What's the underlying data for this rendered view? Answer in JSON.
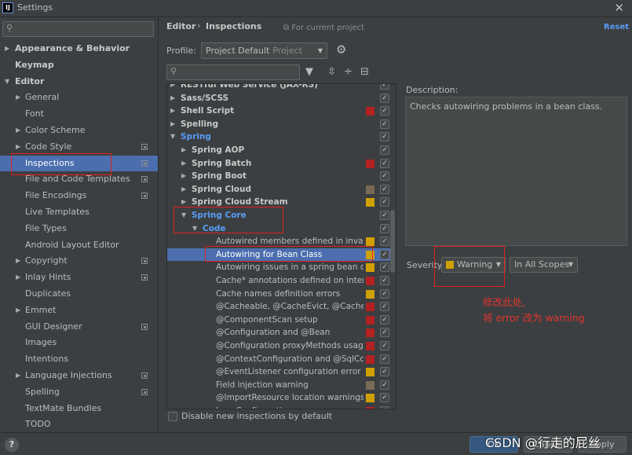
{
  "window": {
    "title": "Settings",
    "app_icon": "IJ"
  },
  "left": {
    "search_placeholder": "",
    "items": [
      {
        "label": "Appearance & Behavior",
        "level": 0,
        "arrow": "right",
        "bold": true
      },
      {
        "label": "Keymap",
        "level": 0,
        "arrow": "",
        "bold": true
      },
      {
        "label": "Editor",
        "level": 0,
        "arrow": "down",
        "bold": true
      },
      {
        "label": "General",
        "level": 1,
        "arrow": "right"
      },
      {
        "label": "Font",
        "level": 1,
        "arrow": ""
      },
      {
        "label": "Color Scheme",
        "level": 1,
        "arrow": "right"
      },
      {
        "label": "Code Style",
        "level": 1,
        "arrow": "right",
        "copy": true
      },
      {
        "label": "Inspections",
        "level": 1,
        "arrow": "",
        "copy": true,
        "selected": true
      },
      {
        "label": "File and Code Templates",
        "level": 1,
        "arrow": "",
        "copy": true
      },
      {
        "label": "File Encodings",
        "level": 1,
        "arrow": "",
        "copy": true
      },
      {
        "label": "Live Templates",
        "level": 1,
        "arrow": ""
      },
      {
        "label": "File Types",
        "level": 1,
        "arrow": ""
      },
      {
        "label": "Android Layout Editor",
        "level": 1,
        "arrow": ""
      },
      {
        "label": "Copyright",
        "level": 1,
        "arrow": "right",
        "copy": true
      },
      {
        "label": "Inlay Hints",
        "level": 1,
        "arrow": "right",
        "copy": true
      },
      {
        "label": "Duplicates",
        "level": 1,
        "arrow": ""
      },
      {
        "label": "Emmet",
        "level": 1,
        "arrow": "right"
      },
      {
        "label": "GUI Designer",
        "level": 1,
        "arrow": "",
        "copy": true
      },
      {
        "label": "Images",
        "level": 1,
        "arrow": ""
      },
      {
        "label": "Intentions",
        "level": 1,
        "arrow": ""
      },
      {
        "label": "Language Injections",
        "level": 1,
        "arrow": "right",
        "copy": true
      },
      {
        "label": "Spelling",
        "level": 1,
        "arrow": "",
        "copy": true
      },
      {
        "label": "TextMate Bundles",
        "level": 1,
        "arrow": ""
      },
      {
        "label": "TODO",
        "level": 1,
        "arrow": ""
      }
    ]
  },
  "header": {
    "crumb_1": "Editor",
    "crumb_sep": "›",
    "crumb_2": "Inspections",
    "project_note": "For current project",
    "reset": "Reset"
  },
  "profile": {
    "label": "Profile:",
    "value": "Project Default",
    "scope": "Project"
  },
  "inspections": {
    "rows": [
      {
        "label": "RESTful Web Service (JAX-RS)",
        "level": 0,
        "arrow": "right",
        "style": "bold",
        "sev": "",
        "checked": true
      },
      {
        "label": "Sass/SCSS",
        "level": 0,
        "arrow": "right",
        "style": "bold",
        "sev": "",
        "checked": true
      },
      {
        "label": "Shell Script",
        "level": 0,
        "arrow": "right",
        "style": "bold",
        "sev": "#b32121",
        "checked": true
      },
      {
        "label": "Spelling",
        "level": 0,
        "arrow": "right",
        "style": "bold",
        "sev": "",
        "checked": true
      },
      {
        "label": "Spring",
        "level": 0,
        "arrow": "down",
        "style": "blue",
        "sev": "",
        "checked": true
      },
      {
        "label": "Spring AOP",
        "level": 1,
        "arrow": "right",
        "style": "bold",
        "sev": "",
        "checked": true
      },
      {
        "label": "Spring Batch",
        "level": 1,
        "arrow": "right",
        "style": "bold",
        "sev": "#b32121",
        "checked": true
      },
      {
        "label": "Spring Boot",
        "level": 1,
        "arrow": "right",
        "style": "bold",
        "sev": "",
        "checked": true
      },
      {
        "label": "Spring Cloud",
        "level": 1,
        "arrow": "right",
        "style": "bold",
        "sev": "#7a6a55",
        "checked": true
      },
      {
        "label": "Spring Cloud Stream",
        "level": 1,
        "arrow": "right",
        "style": "bold",
        "sev": "#d0a000",
        "checked": true
      },
      {
        "label": "Spring Core",
        "level": 1,
        "arrow": "down",
        "style": "blue",
        "sev": "",
        "checked": true
      },
      {
        "label": "Code",
        "level": 2,
        "arrow": "down",
        "style": "blue",
        "sev": "",
        "checked": true
      },
      {
        "label": "Autowired members defined in invalid Sp",
        "level": 3,
        "arrow": "",
        "style": "",
        "sev": "#d0a000",
        "checked": true
      },
      {
        "label": "Autowiring for Bean Class",
        "level": 3,
        "arrow": "",
        "style": "selected",
        "sev": "#d0a000",
        "checked": true
      },
      {
        "label": "Autowiring issues in a spring bean class",
        "level": 3,
        "arrow": "",
        "style": "",
        "sev": "#d0a000",
        "checked": true
      },
      {
        "label": "Cache* annotations defined on interface",
        "level": 3,
        "arrow": "",
        "style": "",
        "sev": "#b32121",
        "checked": true
      },
      {
        "label": "Cache names definition errors",
        "level": 3,
        "arrow": "",
        "style": "",
        "sev": "#d0a000",
        "checked": true
      },
      {
        "label": "@Cacheable, @CacheEvict, @CachePut, @",
        "level": 3,
        "arrow": "",
        "style": "",
        "sev": "#b32121",
        "checked": true
      },
      {
        "label": "@ComponentScan setup",
        "level": 3,
        "arrow": "",
        "style": "",
        "sev": "#b32121",
        "checked": true
      },
      {
        "label": "@Configuration and @Bean",
        "level": 3,
        "arrow": "",
        "style": "",
        "sev": "#b32121",
        "checked": true
      },
      {
        "label": "@Configuration proxyMethods usage w",
        "level": 3,
        "arrow": "",
        "style": "",
        "sev": "#b32121",
        "checked": true
      },
      {
        "label": "@ContextConfiguration and @SqlConfig",
        "level": 3,
        "arrow": "",
        "style": "",
        "sev": "#b32121",
        "checked": true
      },
      {
        "label": "@EventListener configuration error",
        "level": 3,
        "arrow": "",
        "style": "",
        "sev": "#d0a000",
        "checked": true
      },
      {
        "label": "Field injection warning",
        "level": 3,
        "arrow": "",
        "style": "",
        "sev": "#7a6a55",
        "checked": true
      },
      {
        "label": "@ImportResource location warnings",
        "level": 3,
        "arrow": "",
        "style": "",
        "sev": "#d0a000",
        "checked": true
      },
      {
        "label": "Java Configuration",
        "level": 3,
        "arrow": "",
        "style": "",
        "sev": "#b32121",
        "checked": true
      }
    ],
    "disable_new_label": "Disable new inspections by default"
  },
  "description": {
    "label": "Description:",
    "text": "Checks autowiring problems in a bean class."
  },
  "severity": {
    "label": "Severity:",
    "value": "Warning",
    "scope": "In All Scopes"
  },
  "annotation": {
    "line1": "修改此处,",
    "line2": "将 error 改为 warning"
  },
  "buttons": {
    "ok": "OK",
    "cancel": "Cancel",
    "apply": "Apply"
  },
  "watermark": "CSDN @行走的屁丝",
  "colors": {
    "selection": "#4b6eaf",
    "link": "#589df6",
    "annotation": "#e0352c",
    "warning": "#d0a000",
    "error": "#b32121"
  }
}
